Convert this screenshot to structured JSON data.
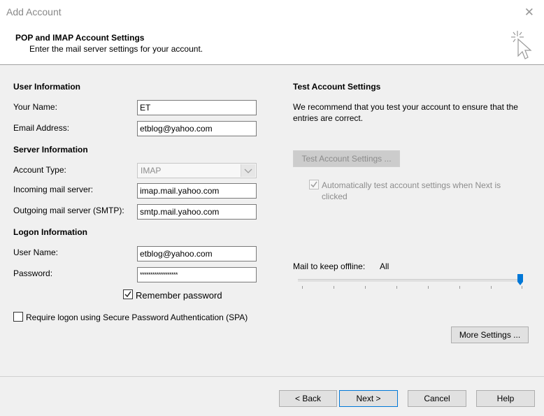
{
  "window": {
    "title": "Add Account",
    "close_glyph": "✕"
  },
  "header": {
    "title": "POP and IMAP Account Settings",
    "subtitle": "Enter the mail server settings for your account.",
    "icon": "cursor-click-icon"
  },
  "user_information": {
    "heading": "User Information",
    "your_name_label": "Your Name:",
    "your_name_value": "ET",
    "email_label": "Email Address:",
    "email_value": "etblog@yahoo.com"
  },
  "server_information": {
    "heading": "Server Information",
    "account_type_label": "Account Type:",
    "account_type_value": "IMAP",
    "incoming_label": "Incoming mail server:",
    "incoming_value": "imap.mail.yahoo.com",
    "outgoing_label": "Outgoing mail server (SMTP):",
    "outgoing_value": "smtp.mail.yahoo.com"
  },
  "logon_information": {
    "heading": "Logon Information",
    "username_label": "User Name:",
    "username_value": "etblog@yahoo.com",
    "password_label": "Password:",
    "password_value": "******************",
    "remember_label": "Remember password",
    "remember_checked": true,
    "spa_label": "Require logon using Secure Password Authentication (SPA)",
    "spa_checked": false
  },
  "test_settings": {
    "heading": "Test Account Settings",
    "description": "We recommend that you test your account to ensure that the entries are correct.",
    "test_button": "Test Account Settings ...",
    "auto_test_label": "Automatically test account settings when Next is clicked",
    "auto_test_checked": true
  },
  "offline": {
    "label": "Mail to keep offline:",
    "value": "All",
    "slider_fraction": 1.0
  },
  "buttons": {
    "more_settings": "More Settings ...",
    "back": "< Back",
    "next": "Next >",
    "cancel": "Cancel",
    "help": "Help"
  },
  "colors": {
    "slider_thumb": "#0078d7",
    "accent": "#0078d7"
  }
}
